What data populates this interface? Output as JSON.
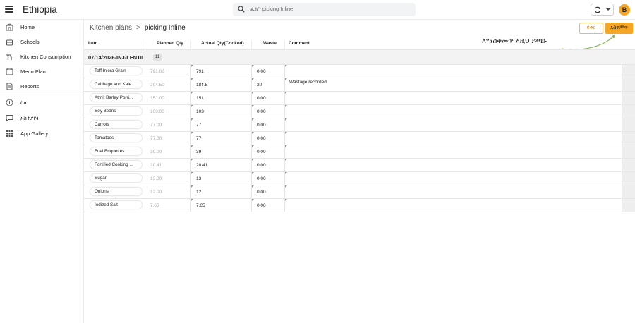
{
  "app": {
    "title": "Ethiopia",
    "search_placeholder": "ፈልግ picking Inline",
    "user_initial": "B"
  },
  "sidebar": {
    "items": [
      {
        "label": "Home",
        "icon": "home-icon"
      },
      {
        "label": "Schools",
        "icon": "school-icon"
      },
      {
        "label": "Kitchen Consumption",
        "icon": "utensils-icon"
      },
      {
        "label": "Menu Plan",
        "icon": "calendar-icon"
      },
      {
        "label": "Reports",
        "icon": "document-icon"
      },
      {
        "label": "ስለ",
        "icon": "info-icon"
      },
      {
        "label": "አስተያየት",
        "icon": "feedback-icon"
      },
      {
        "label": "App Gallery",
        "icon": "grid-icon"
      }
    ]
  },
  "breadcrumb": {
    "parent": "Kitchen plans",
    "separator": ">",
    "current": "picking Inline"
  },
  "actions": {
    "cancel_label": "ይቅር",
    "confirm_label": "አስቀምጥ",
    "hint": "ለማስቀመጥ እዚህ ይጫኑ",
    "accent_color": "#f5a623"
  },
  "table": {
    "columns": [
      "Item",
      "Planned Qty",
      "Actual Qty(Cooked)",
      "Waste",
      "Comment"
    ],
    "group": {
      "title": "07/14/2026-INJ-LENTIL",
      "count": "11"
    },
    "rows": [
      {
        "item": "Teff Injera Grain",
        "planned": "791.00",
        "actual": "791",
        "waste": "0.00",
        "comment": ""
      },
      {
        "item": "Cabbage and Kale",
        "planned": "204.50",
        "actual": "184.5",
        "waste": "20",
        "comment": "Wastage recorded"
      },
      {
        "item": "Atmit Barley Porri...",
        "planned": "151.00",
        "actual": "151",
        "waste": "0.00",
        "comment": ""
      },
      {
        "item": "Soy Beans",
        "planned": "103.00",
        "actual": "103",
        "waste": "0.00",
        "comment": ""
      },
      {
        "item": "Carrots",
        "planned": "77.00",
        "actual": "77",
        "waste": "0.00",
        "comment": ""
      },
      {
        "item": "Tomatoes",
        "planned": "77.00",
        "actual": "77",
        "waste": "0.00",
        "comment": ""
      },
      {
        "item": "Fuel Briquettes",
        "planned": "39.00",
        "actual": "39",
        "waste": "0.00",
        "comment": ""
      },
      {
        "item": "Fortified Cooking ...",
        "planned": "20.41",
        "actual": "20.41",
        "waste": "0.00",
        "comment": ""
      },
      {
        "item": "Sugar",
        "planned": "13.00",
        "actual": "13",
        "waste": "0.00",
        "comment": ""
      },
      {
        "item": "Onions",
        "planned": "12.00",
        "actual": "12",
        "waste": "0.00",
        "comment": ""
      },
      {
        "item": "Iodized Salt",
        "planned": "7.65",
        "actual": "7.65",
        "waste": "0.00",
        "comment": ""
      }
    ]
  }
}
